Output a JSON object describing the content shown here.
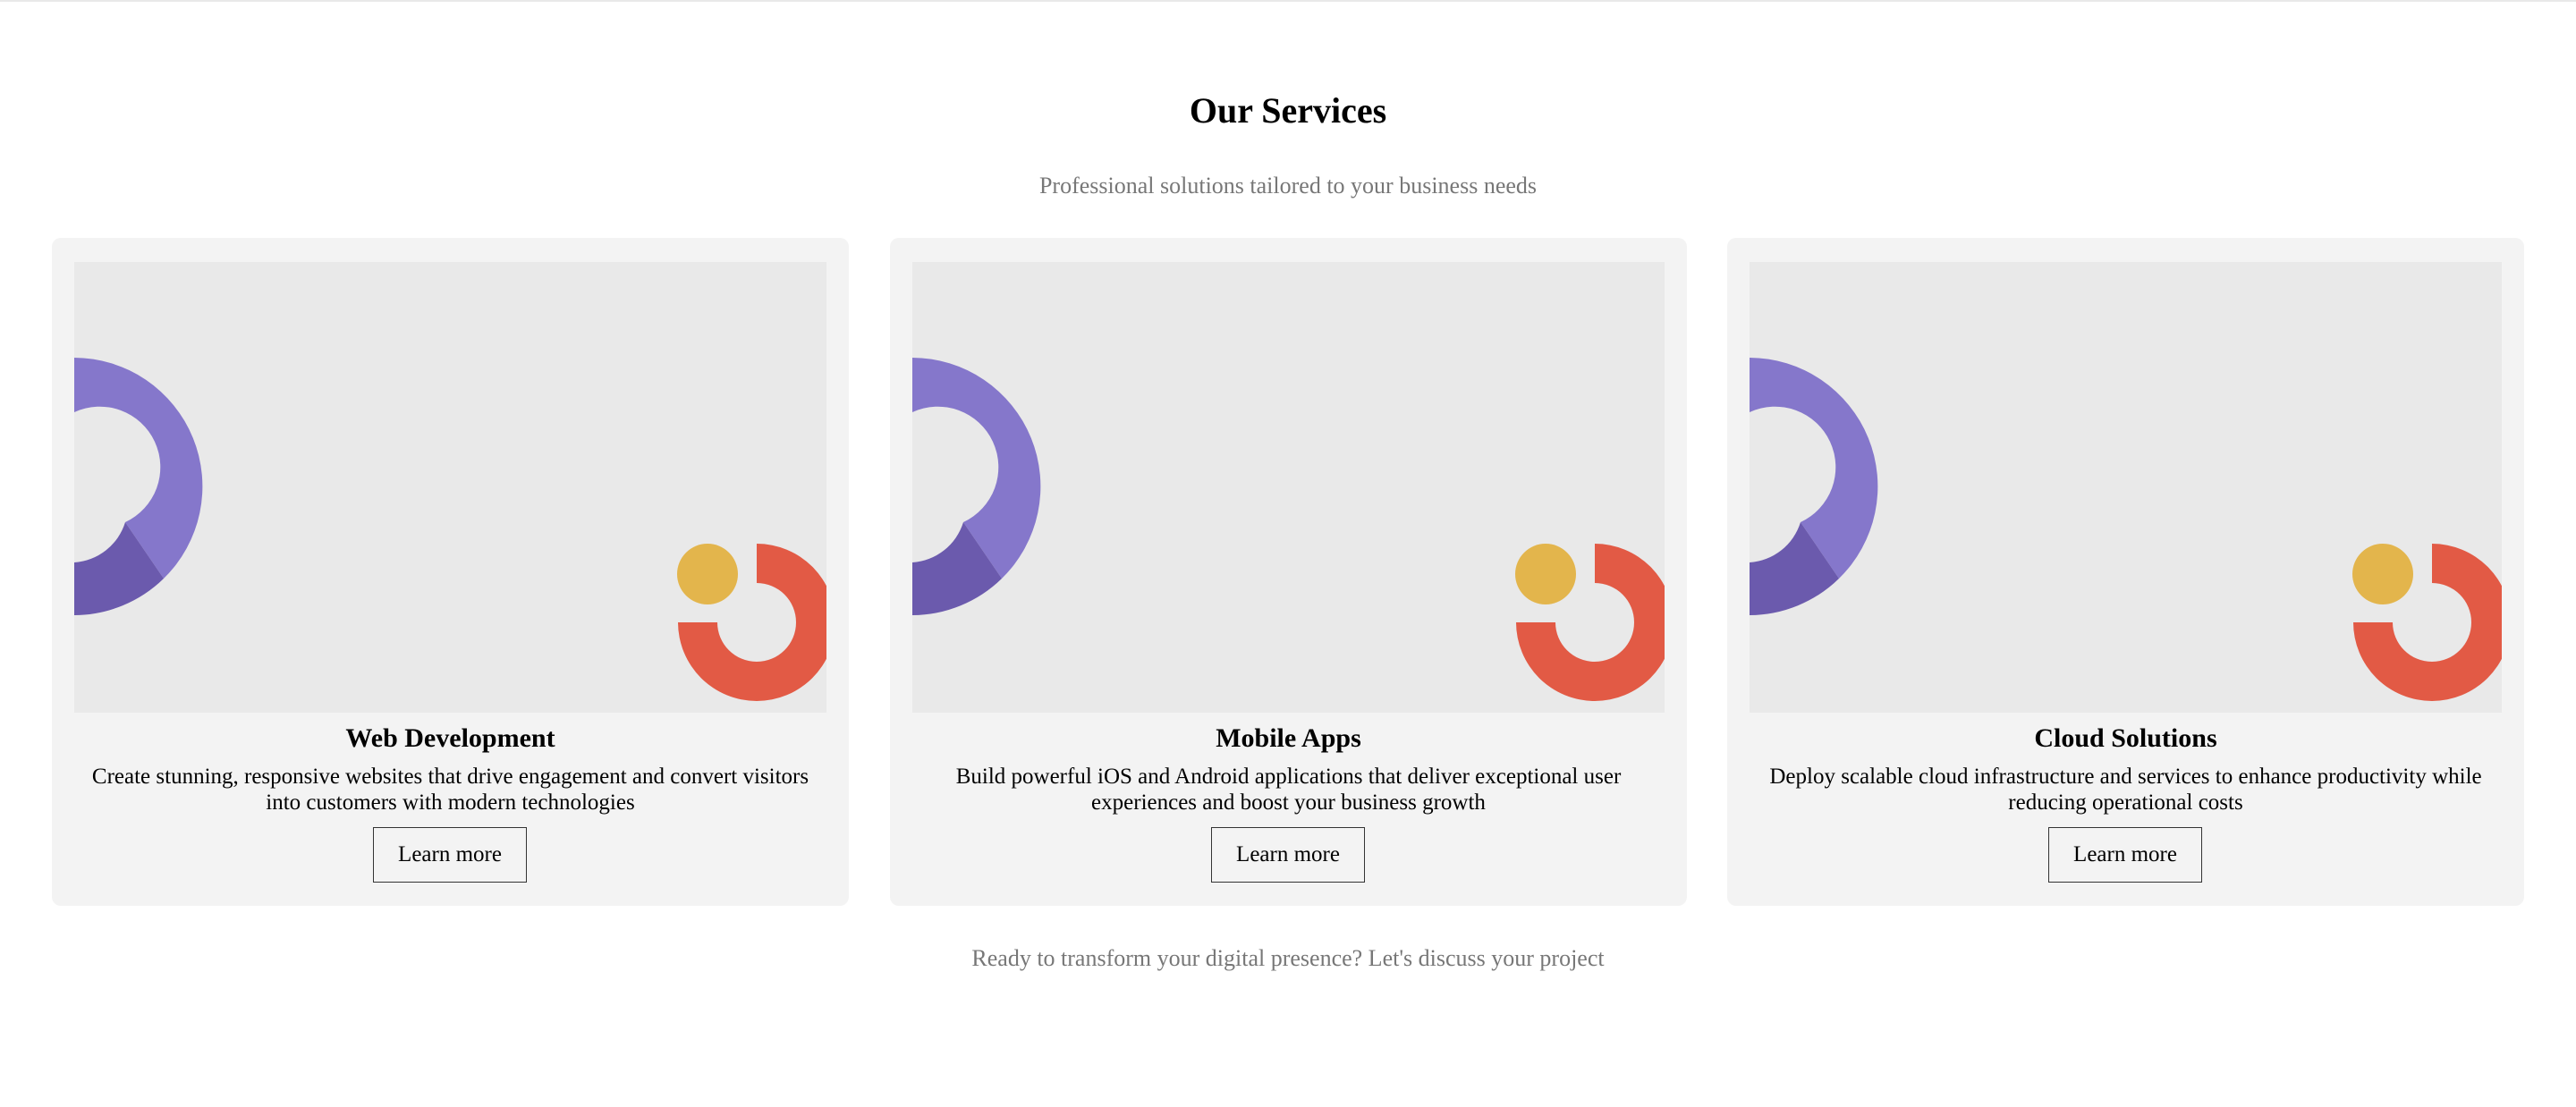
{
  "services": {
    "title": "Our Services",
    "subtitle": "Professional solutions tailored to your business needs",
    "cards": [
      {
        "title": "Web Development",
        "description": "Create stunning, responsive websites that drive engagement and convert visitors into customers with modern technologies",
        "button_label": "Learn more"
      },
      {
        "title": "Mobile Apps",
        "description": "Build powerful iOS and Android applications that deliver exceptional user experiences and boost your business growth",
        "button_label": "Learn more"
      },
      {
        "title": "Cloud Solutions",
        "description": "Deploy scalable cloud infrastructure and services to enhance productivity while reducing operational costs",
        "button_label": "Learn more"
      }
    ],
    "footer_text": "Ready to transform your digital presence? Let's discuss your project"
  },
  "colors": {
    "purple_light": "#8577cb",
    "purple_dark": "#6b5aad",
    "yellow": "#e3b54c",
    "red": "#e25a45",
    "card_bg": "#f3f3f3",
    "image_bg": "#e9e9e9",
    "muted_text": "#777777"
  },
  "illustration": {
    "shapes": [
      "purple-ring-arc",
      "yellow-dot",
      "red-ring-arc"
    ]
  }
}
